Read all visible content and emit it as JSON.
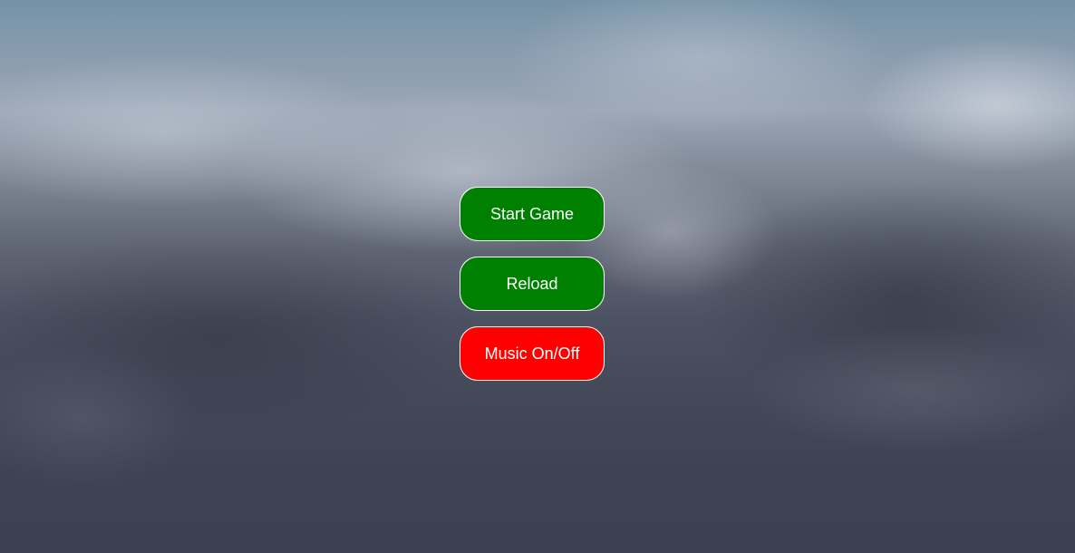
{
  "menu": {
    "buttons": [
      {
        "label": "Start Game",
        "color": "#008000"
      },
      {
        "label": "Reload",
        "color": "#008000"
      },
      {
        "label": "Music On/Off",
        "color": "#ff0000"
      }
    ]
  },
  "background": {
    "scene": "stormy-cloud-sky"
  }
}
